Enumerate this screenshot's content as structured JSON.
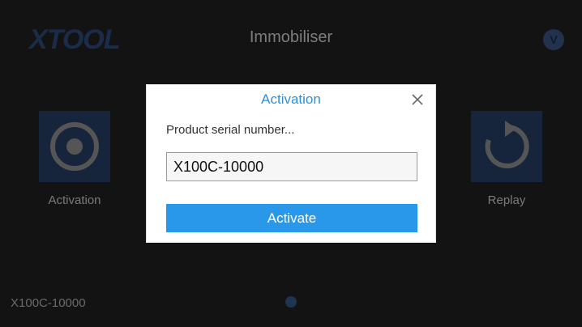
{
  "header": {
    "logo_text": "XTOOL",
    "title": "Immobiliser",
    "badge_letter": "V"
  },
  "tiles": [
    {
      "label": "Activation",
      "icon": "target-icon"
    },
    {
      "label": "Replay",
      "icon": "replay-icon"
    }
  ],
  "footer": {
    "serial": "X100C-10000"
  },
  "dialog": {
    "title": "Activation",
    "field_label": "Product serial number...",
    "serial_value": "X100C-10000",
    "activate_label": "Activate"
  },
  "colors": {
    "accent": "#2a98ea",
    "title_blue": "#2f8fd8",
    "background": "#131313"
  }
}
